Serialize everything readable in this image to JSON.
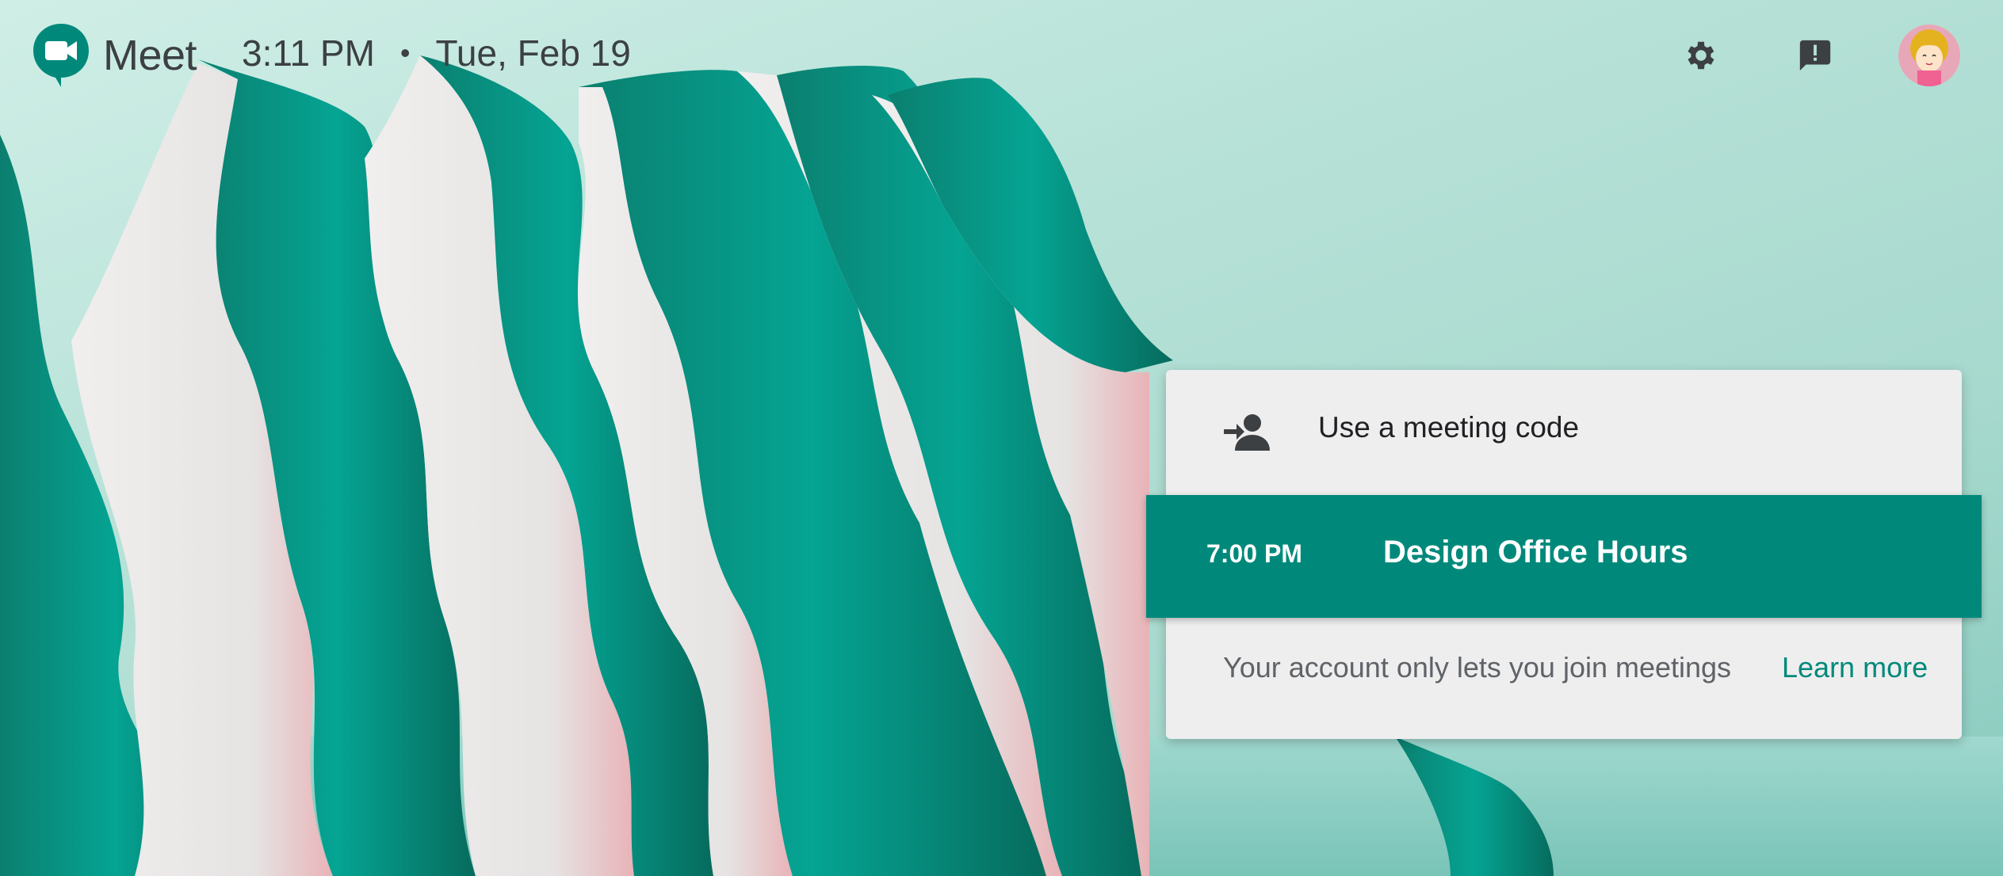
{
  "header": {
    "app_name": "Meet",
    "time": "3:11 PM",
    "separator": "•",
    "date": "Tue, Feb 19",
    "icons": [
      "meet-logo-icon",
      "settings-gear-icon",
      "feedback-icon",
      "user-avatar"
    ]
  },
  "card": {
    "meeting_code_label": "Use a meeting code",
    "meeting_code_icon": "person-add-arrow-icon",
    "event": {
      "time": "7:00 PM",
      "title": "Design Office Hours"
    },
    "notice_text": "Your account only lets you join meetings",
    "learn_more_label": "Learn more"
  },
  "colors": {
    "accent": "#00897b",
    "background": "#b8e2d8",
    "card": "#eeeeee",
    "text_dark": "#3c4043"
  }
}
